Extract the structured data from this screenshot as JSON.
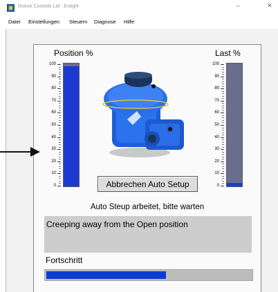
{
  "window": {
    "title": "Rotork Controls Ltd - Enlight",
    "minimize_glyph": "–",
    "close_glyph": "✕"
  },
  "menubar": {
    "items": [
      "Datei",
      "Einstellungen",
      "Steuern",
      "Diagnose",
      "Hilfe"
    ]
  },
  "gauges": {
    "position": {
      "label": "Position %",
      "value_percent": 98
    },
    "last": {
      "label": "Last %",
      "value_percent": 3
    },
    "tick_labels": [
      "100",
      "90",
      "80",
      "70",
      "60",
      "50",
      "40",
      "30",
      "20",
      "10",
      "0"
    ]
  },
  "actions": {
    "cancel_auto_setup": "Abbrechen Auto Setup"
  },
  "status": {
    "headline": "Auto Steup arbeitet, bitte warten",
    "message": "Creeping away from the Open position"
  },
  "progress": {
    "label": "Fortschritt",
    "value_percent": 59
  },
  "colors": {
    "bar_fill": "#1d3ad0",
    "bar_empty": "#6a6e8c",
    "progress_fill": "#0a3bd4",
    "actuator_body": "#1f5fd6"
  },
  "icons": {
    "app": "rotork-app-icon",
    "pointer": "arrow-icon",
    "device": "actuator-image"
  }
}
